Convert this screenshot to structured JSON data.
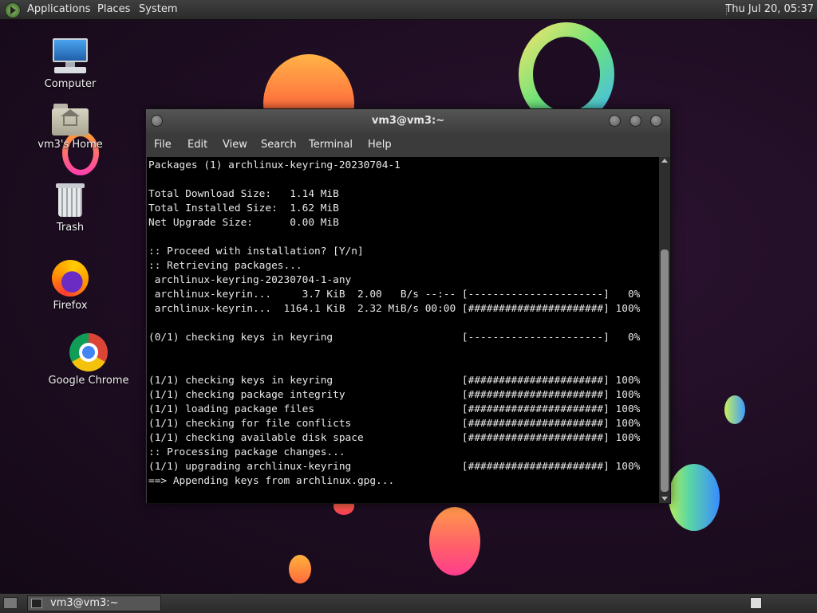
{
  "top_panel": {
    "menus": [
      "Applications",
      "Places",
      "System"
    ],
    "clock": "Thu Jul 20, 05:37"
  },
  "desktop_icons": [
    {
      "label": "Computer",
      "icon": "computer-icon"
    },
    {
      "label": "vm3's Home",
      "icon": "home-folder-icon"
    },
    {
      "label": "Trash",
      "icon": "trash-icon"
    },
    {
      "label": "Firefox",
      "icon": "firefox-icon"
    },
    {
      "label": "Google Chrome",
      "icon": "chrome-icon"
    }
  ],
  "terminal": {
    "title": "vm3@vm3:~",
    "menu": [
      "File",
      "Edit",
      "View",
      "Search",
      "Terminal",
      "Help"
    ],
    "lines": [
      "Packages (1) archlinux-keyring-20230704-1",
      "",
      "Total Download Size:   1.14 MiB",
      "Total Installed Size:  1.62 MiB",
      "Net Upgrade Size:      0.00 MiB",
      "",
      ":: Proceed with installation? [Y/n]",
      ":: Retrieving packages...",
      " archlinux-keyring-20230704-1-any",
      " archlinux-keyrin...     3.7 KiB  2.00   B/s --:-- [----------------------]   0%",
      " archlinux-keyrin...  1164.1 KiB  2.32 MiB/s 00:00 [######################] 100%",
      "",
      "(0/1) checking keys in keyring                     [----------------------]   0%",
      "",
      "",
      "(1/1) checking keys in keyring                     [######################] 100%",
      "(1/1) checking package integrity                   [######################] 100%",
      "(1/1) loading package files                        [######################] 100%",
      "(1/1) checking for file conflicts                  [######################] 100%",
      "(1/1) checking available disk space                [######################] 100%",
      ":: Processing package changes...",
      "(1/1) upgrading archlinux-keyring                  [######################] 100%",
      "==> Appending keys from archlinux.gpg..."
    ]
  },
  "taskbar": {
    "tasks": [
      "vm3@vm3:~"
    ]
  }
}
